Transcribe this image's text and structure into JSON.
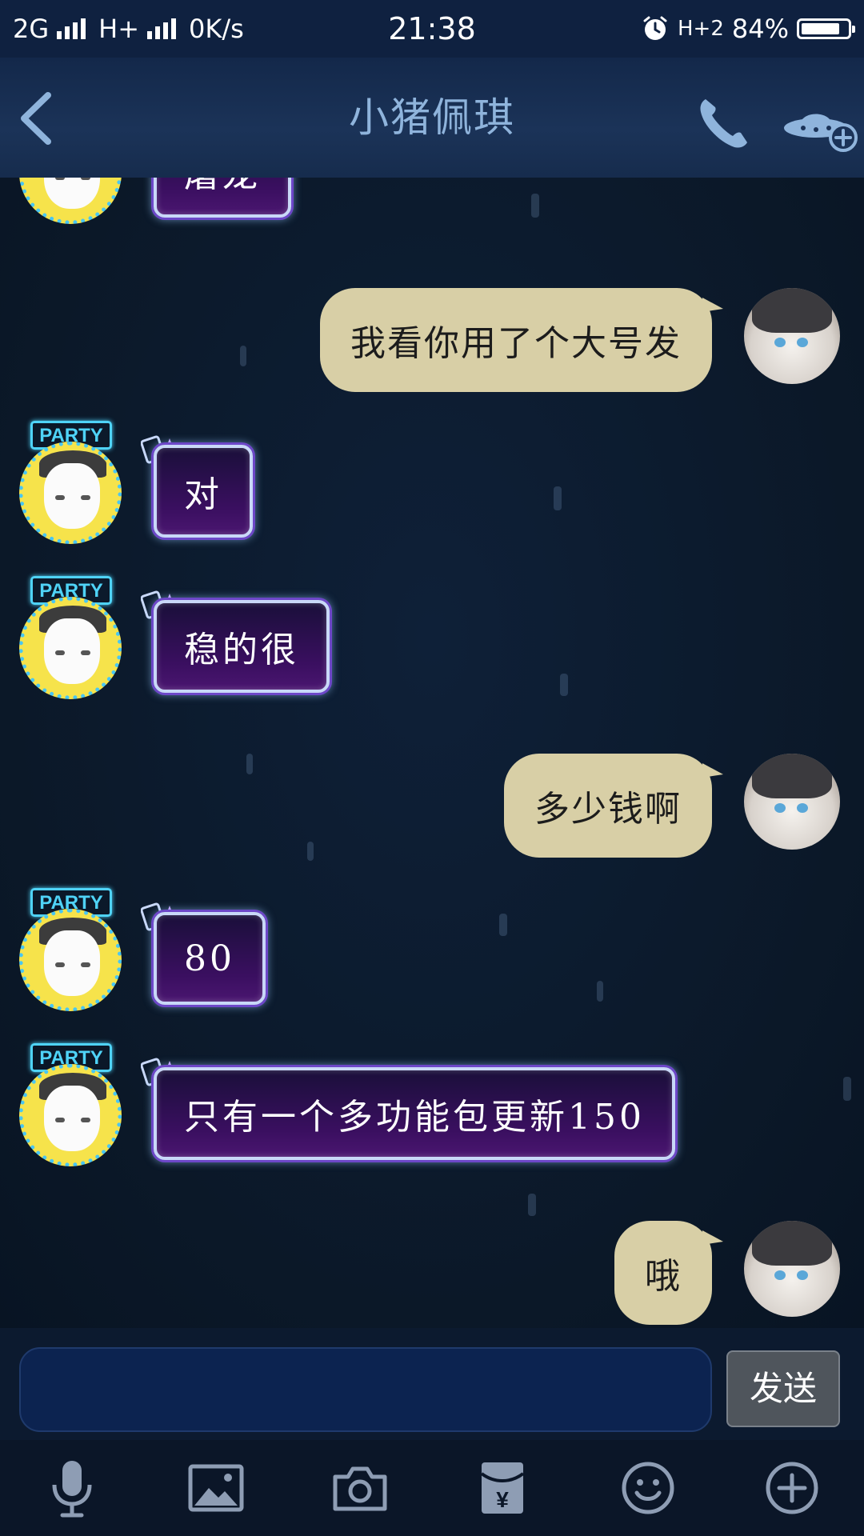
{
  "status_bar": {
    "network1": "2G",
    "network2": "H+",
    "speed": "0K/s",
    "time": "21:38",
    "network3": "H+2",
    "battery": "84%",
    "battery_level": 0.84
  },
  "header": {
    "title": "小猪佩琪"
  },
  "badge_label": "PARTY",
  "messages": [
    {
      "side": "left",
      "text": "屠龙"
    },
    {
      "side": "right",
      "text": "我看你用了个大号发"
    },
    {
      "side": "left",
      "text": "对"
    },
    {
      "side": "left",
      "text": "稳的很"
    },
    {
      "side": "right",
      "text": "多少钱啊"
    },
    {
      "side": "left",
      "text": "80"
    },
    {
      "side": "left",
      "text": "只有一个多功能包更新150"
    },
    {
      "side": "right",
      "text": "哦"
    }
  ],
  "input": {
    "value": "",
    "send_label": "发送"
  },
  "toolbar": [
    "microphone-icon",
    "image-icon",
    "camera-icon",
    "red-packet-icon",
    "emoji-icon",
    "plus-icon"
  ],
  "colors": {
    "background": "#0c1a2e",
    "title": "#8fb4dc",
    "right_bubble": "#d8cfa6",
    "left_bubble": "#3a0f60",
    "party_badge": "#4fd3f7"
  }
}
